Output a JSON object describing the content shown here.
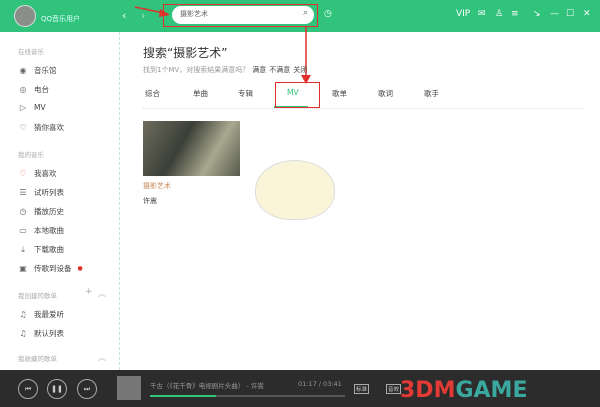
{
  "header": {
    "username": "QQ音乐用户",
    "search_value": "摄影艺术",
    "vip": "VIP"
  },
  "sidebar": {
    "online_title": "在线音乐",
    "online": [
      "音乐馆",
      "电台",
      "MV",
      "猜你喜欢"
    ],
    "mine_title": "我的音乐",
    "mine": [
      "我喜欢",
      "试听列表",
      "播放历史",
      "本地歌曲",
      "下载歌曲",
      "传歌到设备"
    ],
    "created_title": "我创建的歌单",
    "created": [
      "我最爱听",
      "默认列表"
    ],
    "collected_title": "我收藏的歌单"
  },
  "main": {
    "title": "搜索“摄影艺术”",
    "subtitle": "找到1个MV，对搜索结果满意吗？",
    "satisfied": "满意",
    "unsatisfied": "不满意",
    "close": "关闭",
    "tabs": [
      "综合",
      "单曲",
      "专辑",
      "MV",
      "歌单",
      "歌词",
      "歌手"
    ],
    "active_tab": "MV",
    "results": [
      {
        "title": "摄影艺术",
        "artist": "许嵩"
      }
    ]
  },
  "player": {
    "track": "千古（《花千骨》电视剧片头曲） - 许嵩",
    "time": "01:17 / 03:41",
    "progress": 0.34,
    "quality": "标准",
    "effect": "音效"
  },
  "watermark": {
    "text1": "3DM",
    "text2": "GAME"
  },
  "colors": {
    "accent": "#31c27c",
    "highlight": "#e0302b"
  }
}
